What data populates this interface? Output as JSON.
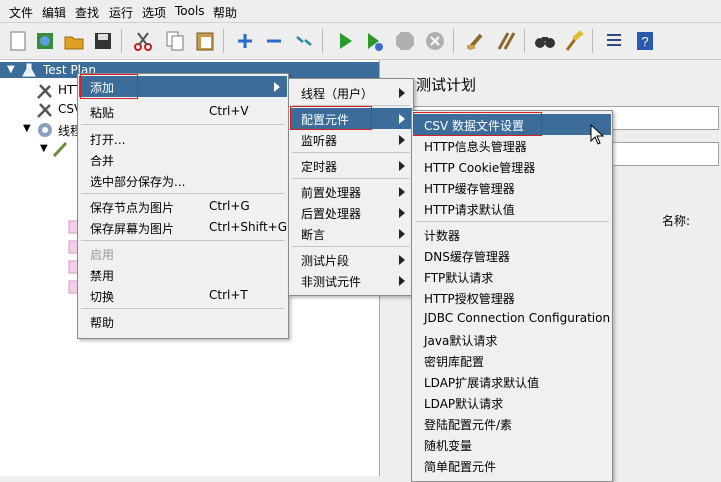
{
  "menubar": [
    "文件",
    "编辑",
    "查找",
    "运行",
    "选项",
    "Tools",
    "帮助"
  ],
  "tree": {
    "root": "Test Plan",
    "nodes": [
      "HTT",
      "CSV",
      "线程"
    ]
  },
  "panel": {
    "title": "测试计划",
    "name_label": "名称:"
  },
  "context_menu": {
    "items": [
      {
        "label": "添加",
        "shortcut": ""
      },
      {
        "label": "粘贴",
        "shortcut": "Ctrl+V"
      },
      {
        "label": "打开...",
        "shortcut": ""
      },
      {
        "label": "合并",
        "shortcut": ""
      },
      {
        "label": "选中部分保存为...",
        "shortcut": ""
      },
      {
        "label": "保存节点为图片",
        "shortcut": "Ctrl+G"
      },
      {
        "label": "保存屏幕为图片",
        "shortcut": "Ctrl+Shift+G"
      },
      {
        "label": "启用",
        "shortcut": ""
      },
      {
        "label": "禁用",
        "shortcut": ""
      },
      {
        "label": "切换",
        "shortcut": "Ctrl+T"
      },
      {
        "label": "帮助",
        "shortcut": ""
      }
    ]
  },
  "add_submenu": {
    "items": [
      "线程（用户）",
      "配置元件",
      "监听器",
      "定时器",
      "前置处理器",
      "后置处理器",
      "断言",
      "测试片段",
      "非测试元件"
    ]
  },
  "config_submenu": {
    "items": [
      "CSV 数据文件设置",
      "HTTP信息头管理器",
      "HTTP Cookie管理器",
      "HTTP缓存管理器",
      "HTTP请求默认值",
      "计数器",
      "DNS缓存管理器",
      "FTP默认请求",
      "HTTP授权管理器",
      "JDBC Connection Configuration",
      "Java默认请求",
      "密钥库配置",
      "LDAP扩展请求默认值",
      "LDAP默认请求",
      "登陆配置元件/素",
      "随机变量",
      "简单配置元件"
    ]
  },
  "colors": {
    "selection": "#3b6c9a",
    "highlight_box": "#d82020",
    "tree_selected": "#3b6c9a"
  }
}
